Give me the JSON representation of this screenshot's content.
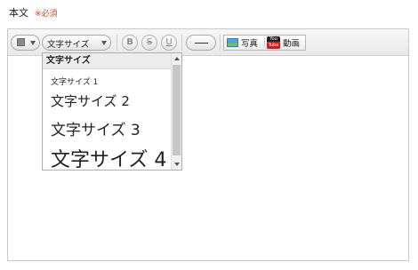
{
  "field": {
    "label": "本文",
    "required_mark": "※必須"
  },
  "toolbar": {
    "text_color_value": "#8a8a8a",
    "font_size_selected": "文字サイズ",
    "bold_label": "B",
    "strike_label": "S",
    "underline_label": "U",
    "photo_label": "写真",
    "video_label": "動画",
    "youtube_top": "You",
    "youtube_bottom": "Tube"
  },
  "font_size_dropdown": {
    "header": "文字サイズ",
    "options": [
      "文字サイズ 1",
      "文字サイズ 2",
      "文字サイズ 3",
      "文字サイズ 4"
    ]
  },
  "colors": {
    "required": "#e0401a",
    "border": "#c9c9c9",
    "youtube_red": "#cc1e1e"
  }
}
